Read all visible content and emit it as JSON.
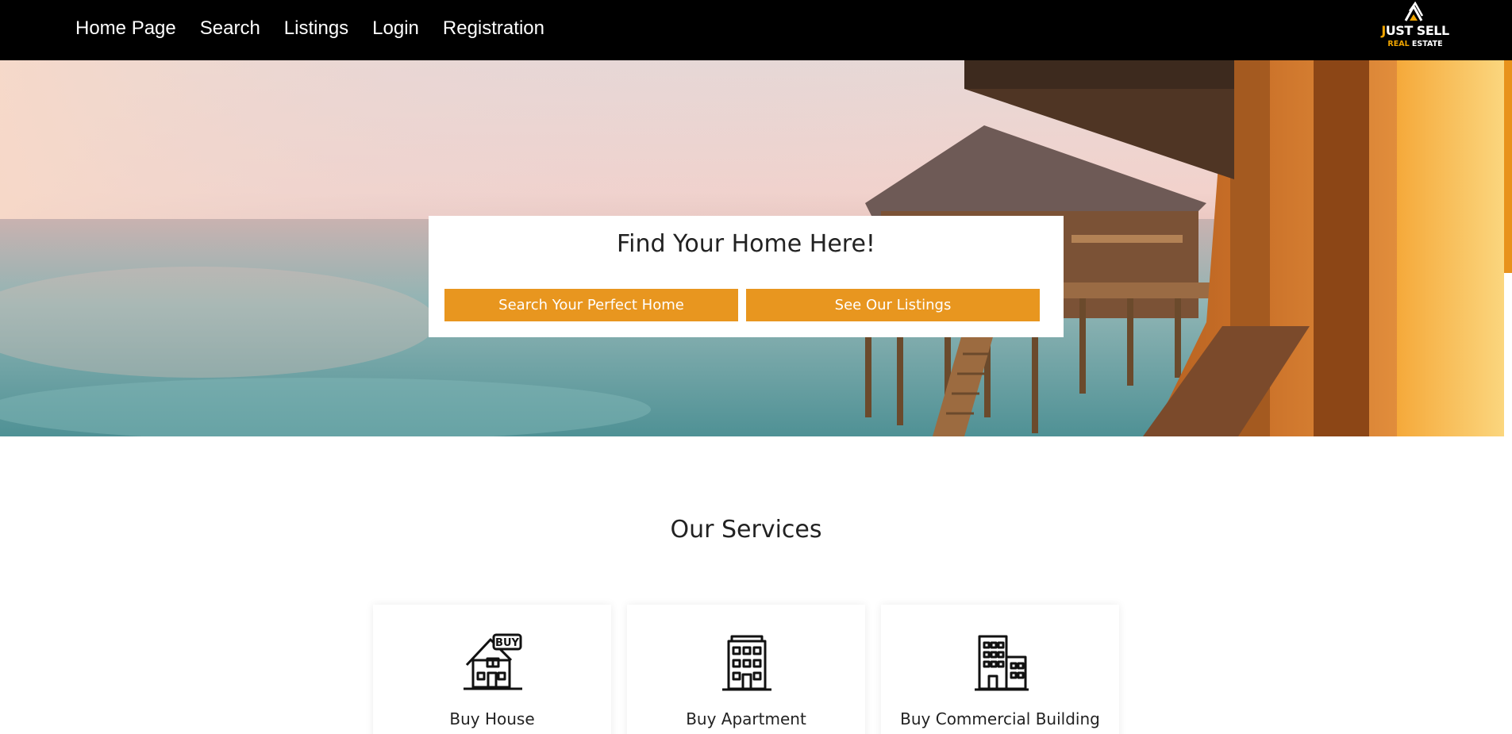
{
  "nav": {
    "links": [
      "Home Page",
      "Search",
      "Listings",
      "Login",
      "Registration"
    ]
  },
  "logo": {
    "main_first": "J",
    "main_rest": "UST SELL",
    "sub_first": "REAL",
    "sub_rest": " ESTATE"
  },
  "hero": {
    "title": "Find Your Home Here!",
    "search_button": "Search Your Perfect Home",
    "listings_button": "See Our Listings"
  },
  "services": {
    "title": "Our Services",
    "items": [
      {
        "label": "Buy House",
        "icon": "buy-house-icon"
      },
      {
        "label": "Buy Apartment",
        "icon": "apartment-building-icon"
      },
      {
        "label": "Buy Commercial Building",
        "icon": "commercial-building-icon"
      }
    ]
  },
  "colors": {
    "accent": "#e8961f",
    "navbar": "#000000",
    "logo_accent": "#f0a500"
  }
}
